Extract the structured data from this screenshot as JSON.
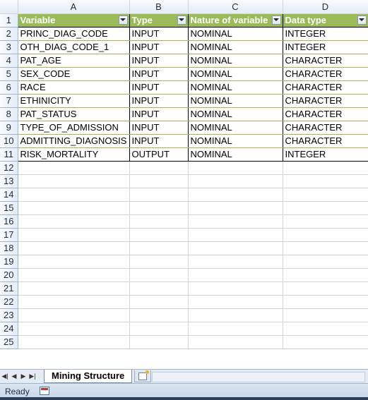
{
  "columns": [
    "A",
    "B",
    "C",
    "D"
  ],
  "table_headers": [
    "Variable",
    "Type",
    "Nature of variable",
    "Data type"
  ],
  "rows": [
    [
      "PRINC_DIAG_CODE",
      "INPUT",
      "NOMINAL",
      "INTEGER"
    ],
    [
      "OTH_DIAG_CODE_1",
      "INPUT",
      "NOMINAL",
      "INTEGER"
    ],
    [
      "PAT_AGE",
      "INPUT",
      "NOMINAL",
      "CHARACTER"
    ],
    [
      "SEX_CODE",
      "INPUT",
      "NOMINAL",
      "CHARACTER"
    ],
    [
      "RACE",
      "INPUT",
      "NOMINAL",
      "CHARACTER"
    ],
    [
      "ETHINICITY",
      "INPUT",
      "NOMINAL",
      "CHARACTER"
    ],
    [
      "PAT_STATUS",
      "INPUT",
      "NOMINAL",
      "CHARACTER"
    ],
    [
      "TYPE_OF_ADMISSION",
      "INPUT",
      "NOMINAL",
      "CHARACTER"
    ],
    [
      "ADMITTING_DIAGNOSIS",
      "INPUT",
      "NOMINAL",
      "CHARACTER"
    ],
    [
      "RISK_MORTALITY",
      "OUTPUT",
      "NOMINAL",
      "INTEGER"
    ]
  ],
  "row_numbers": [
    "1",
    "2",
    "3",
    "4",
    "5",
    "6",
    "7",
    "8",
    "9",
    "10",
    "11",
    "12",
    "13",
    "14",
    "15",
    "16",
    "17",
    "18",
    "19",
    "20",
    "21",
    "22",
    "23",
    "24",
    "25"
  ],
  "sheet_tab": "Mining Structure",
  "status": "Ready",
  "colors": {
    "header_fill": "#9bbb59",
    "header_text": "#ffffff",
    "row_band": "#9bbb59"
  },
  "icons": {
    "filter": "filter-dropdown-icon",
    "insert_sheet": "insert-sheet-icon",
    "macro": "macro-record-icon"
  }
}
